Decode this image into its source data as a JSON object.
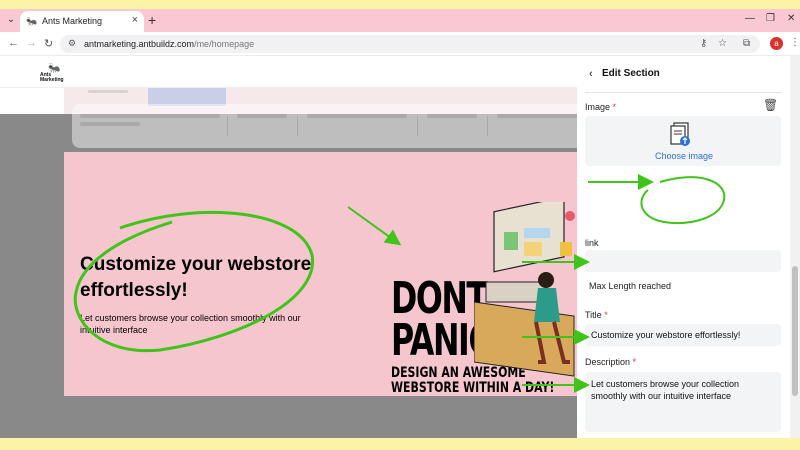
{
  "browser": {
    "tab_title": "Ants Marketing",
    "url_host": "antmarketing.antbuildz.com",
    "url_path": "/me/homepage",
    "profile_initial": "a"
  },
  "site": {
    "logo_text_1": "Ants",
    "logo_text_2": "Marketing"
  },
  "hero": {
    "title": "Customize your webstore effortlessly!",
    "description": "Let customers browse your collection smoothly with our intuitive interface",
    "banner_line1": "DONT",
    "banner_line2": "PANIC!",
    "banner_line3": "DESIGN AN AWESOME",
    "banner_line4": "WEBSTORE WITHIN A DAY!"
  },
  "panel": {
    "title": "Edit Section",
    "image_label": "Image",
    "choose_image": "Choose image",
    "link_label": "link",
    "link_value": "",
    "max_length": "Max Length reached",
    "title_label": "Title",
    "title_value": "Customize your webstore effortlessly!",
    "description_label": "Description",
    "description_value": "Let customers browse your collection smoothly with our intuitive interface",
    "required_mark": "*"
  },
  "colors": {
    "annotation_green": "#3fc41a",
    "tabbar_pink": "#f9c8d3",
    "hero_pink": "#f6c6cf",
    "link_blue": "#2f6fd6"
  }
}
